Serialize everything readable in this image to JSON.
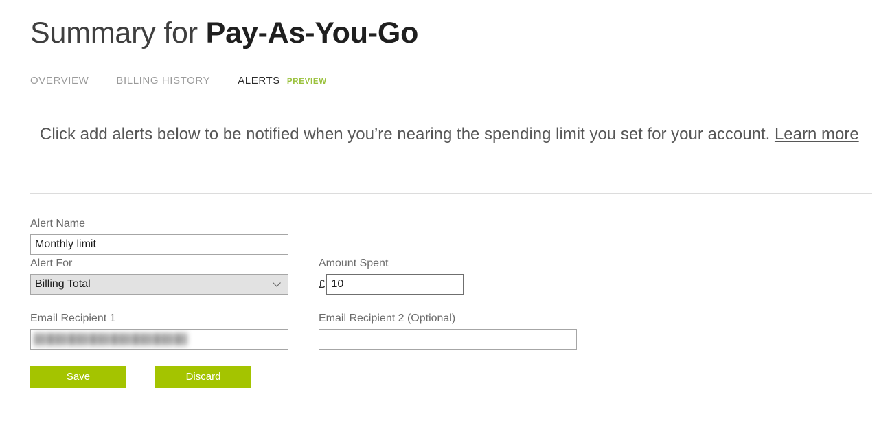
{
  "header": {
    "title_prefix": "Summary for ",
    "title_subject": "Pay-As-You-Go"
  },
  "tabs": [
    {
      "label": "OVERVIEW",
      "active": false
    },
    {
      "label": "BILLING HISTORY",
      "active": false
    },
    {
      "label": "ALERTS",
      "active": true
    }
  ],
  "badges": {
    "preview": "PREVIEW"
  },
  "description": {
    "text": "Click add alerts below to be notified when you’re nearing the spending limit you set for your account. ",
    "link_label": "Learn more"
  },
  "form": {
    "alert_name": {
      "label": "Alert Name",
      "value": "Monthly limit",
      "placeholder": ""
    },
    "alert_for": {
      "label": "Alert For",
      "selected": "Billing Total",
      "options": [
        "Billing Total"
      ]
    },
    "amount_spent": {
      "label": "Amount Spent",
      "currency": "£",
      "value": "10",
      "placeholder": ""
    },
    "email_recipient_1": {
      "label": "Email Recipient 1",
      "value": "",
      "placeholder": "",
      "redacted": true
    },
    "email_recipient_2": {
      "label": "Email Recipient 2 (Optional)",
      "value": "",
      "placeholder": ""
    }
  },
  "actions": {
    "save_label": "Save",
    "discard_label": "Discard"
  },
  "colors": {
    "accent_button": "#A4C400",
    "preview_badge": "#9AC13C",
    "active_tab": "#2B2B2B",
    "inactive_tab": "#9B9B9B",
    "body_text": "#575757",
    "divider": "#DCDCDC"
  },
  "icons": {
    "chevron_down": "chevron-down-icon"
  }
}
